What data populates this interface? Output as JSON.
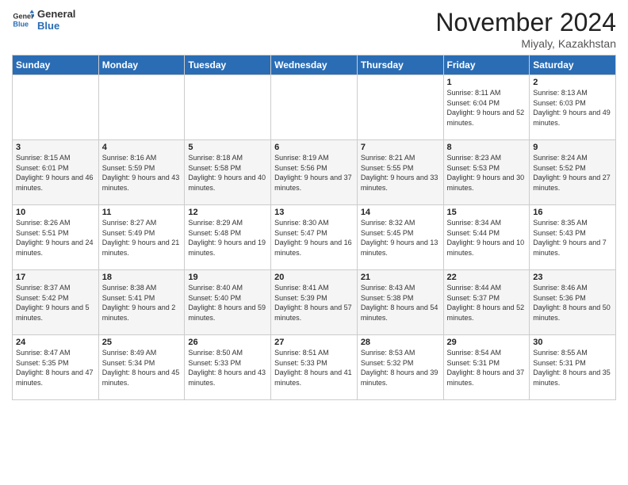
{
  "header": {
    "logo_line1": "General",
    "logo_line2": "Blue",
    "month_title": "November 2024",
    "location": "Miyaly, Kazakhstan"
  },
  "weekdays": [
    "Sunday",
    "Monday",
    "Tuesday",
    "Wednesday",
    "Thursday",
    "Friday",
    "Saturday"
  ],
  "weeks": [
    [
      {
        "day": "",
        "info": ""
      },
      {
        "day": "",
        "info": ""
      },
      {
        "day": "",
        "info": ""
      },
      {
        "day": "",
        "info": ""
      },
      {
        "day": "",
        "info": ""
      },
      {
        "day": "1",
        "info": "Sunrise: 8:11 AM\nSunset: 6:04 PM\nDaylight: 9 hours and 52 minutes."
      },
      {
        "day": "2",
        "info": "Sunrise: 8:13 AM\nSunset: 6:03 PM\nDaylight: 9 hours and 49 minutes."
      }
    ],
    [
      {
        "day": "3",
        "info": "Sunrise: 8:15 AM\nSunset: 6:01 PM\nDaylight: 9 hours and 46 minutes."
      },
      {
        "day": "4",
        "info": "Sunrise: 8:16 AM\nSunset: 5:59 PM\nDaylight: 9 hours and 43 minutes."
      },
      {
        "day": "5",
        "info": "Sunrise: 8:18 AM\nSunset: 5:58 PM\nDaylight: 9 hours and 40 minutes."
      },
      {
        "day": "6",
        "info": "Sunrise: 8:19 AM\nSunset: 5:56 PM\nDaylight: 9 hours and 37 minutes."
      },
      {
        "day": "7",
        "info": "Sunrise: 8:21 AM\nSunset: 5:55 PM\nDaylight: 9 hours and 33 minutes."
      },
      {
        "day": "8",
        "info": "Sunrise: 8:23 AM\nSunset: 5:53 PM\nDaylight: 9 hours and 30 minutes."
      },
      {
        "day": "9",
        "info": "Sunrise: 8:24 AM\nSunset: 5:52 PM\nDaylight: 9 hours and 27 minutes."
      }
    ],
    [
      {
        "day": "10",
        "info": "Sunrise: 8:26 AM\nSunset: 5:51 PM\nDaylight: 9 hours and 24 minutes."
      },
      {
        "day": "11",
        "info": "Sunrise: 8:27 AM\nSunset: 5:49 PM\nDaylight: 9 hours and 21 minutes."
      },
      {
        "day": "12",
        "info": "Sunrise: 8:29 AM\nSunset: 5:48 PM\nDaylight: 9 hours and 19 minutes."
      },
      {
        "day": "13",
        "info": "Sunrise: 8:30 AM\nSunset: 5:47 PM\nDaylight: 9 hours and 16 minutes."
      },
      {
        "day": "14",
        "info": "Sunrise: 8:32 AM\nSunset: 5:45 PM\nDaylight: 9 hours and 13 minutes."
      },
      {
        "day": "15",
        "info": "Sunrise: 8:34 AM\nSunset: 5:44 PM\nDaylight: 9 hours and 10 minutes."
      },
      {
        "day": "16",
        "info": "Sunrise: 8:35 AM\nSunset: 5:43 PM\nDaylight: 9 hours and 7 minutes."
      }
    ],
    [
      {
        "day": "17",
        "info": "Sunrise: 8:37 AM\nSunset: 5:42 PM\nDaylight: 9 hours and 5 minutes."
      },
      {
        "day": "18",
        "info": "Sunrise: 8:38 AM\nSunset: 5:41 PM\nDaylight: 9 hours and 2 minutes."
      },
      {
        "day": "19",
        "info": "Sunrise: 8:40 AM\nSunset: 5:40 PM\nDaylight: 8 hours and 59 minutes."
      },
      {
        "day": "20",
        "info": "Sunrise: 8:41 AM\nSunset: 5:39 PM\nDaylight: 8 hours and 57 minutes."
      },
      {
        "day": "21",
        "info": "Sunrise: 8:43 AM\nSunset: 5:38 PM\nDaylight: 8 hours and 54 minutes."
      },
      {
        "day": "22",
        "info": "Sunrise: 8:44 AM\nSunset: 5:37 PM\nDaylight: 8 hours and 52 minutes."
      },
      {
        "day": "23",
        "info": "Sunrise: 8:46 AM\nSunset: 5:36 PM\nDaylight: 8 hours and 50 minutes."
      }
    ],
    [
      {
        "day": "24",
        "info": "Sunrise: 8:47 AM\nSunset: 5:35 PM\nDaylight: 8 hours and 47 minutes."
      },
      {
        "day": "25",
        "info": "Sunrise: 8:49 AM\nSunset: 5:34 PM\nDaylight: 8 hours and 45 minutes."
      },
      {
        "day": "26",
        "info": "Sunrise: 8:50 AM\nSunset: 5:33 PM\nDaylight: 8 hours and 43 minutes."
      },
      {
        "day": "27",
        "info": "Sunrise: 8:51 AM\nSunset: 5:33 PM\nDaylight: 8 hours and 41 minutes."
      },
      {
        "day": "28",
        "info": "Sunrise: 8:53 AM\nSunset: 5:32 PM\nDaylight: 8 hours and 39 minutes."
      },
      {
        "day": "29",
        "info": "Sunrise: 8:54 AM\nSunset: 5:31 PM\nDaylight: 8 hours and 37 minutes."
      },
      {
        "day": "30",
        "info": "Sunrise: 8:55 AM\nSunset: 5:31 PM\nDaylight: 8 hours and 35 minutes."
      }
    ]
  ]
}
